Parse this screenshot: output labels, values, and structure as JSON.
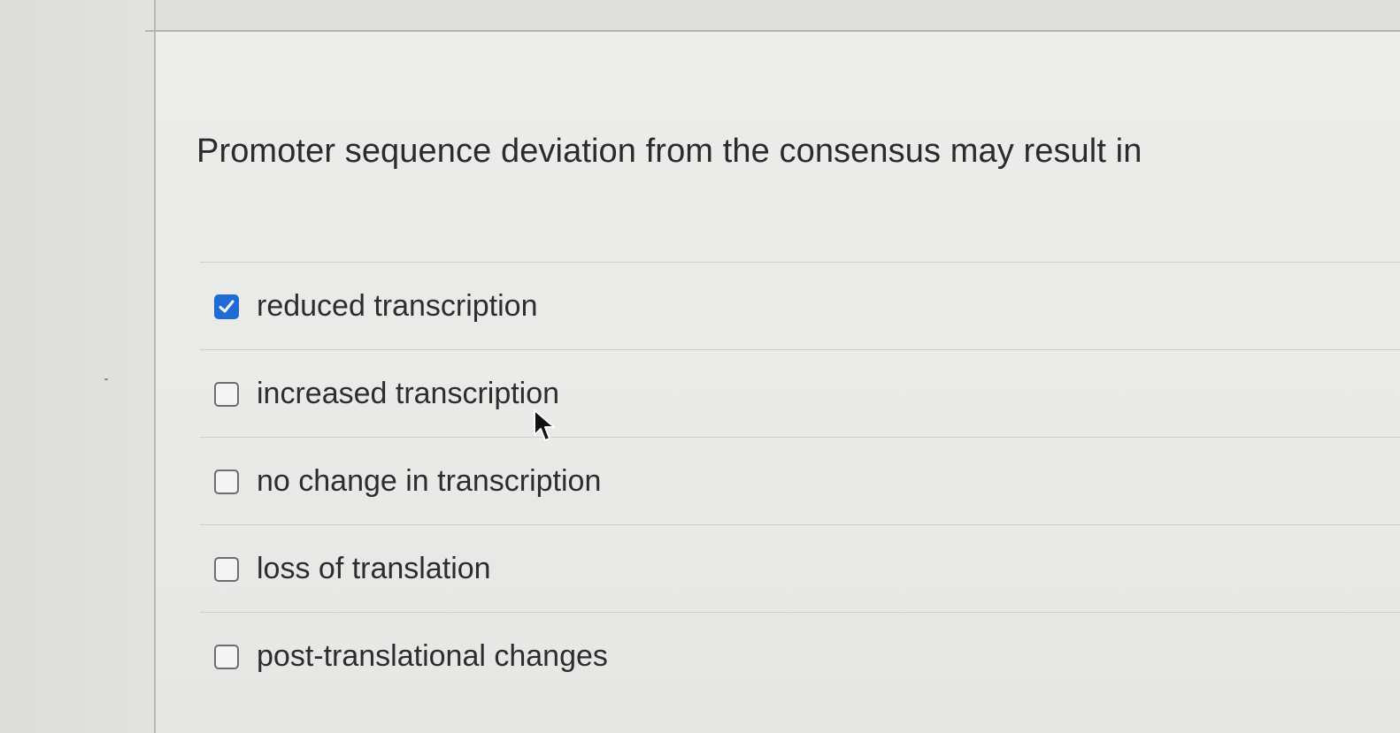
{
  "question": {
    "text": "Promoter sequence deviation from the consensus may result in"
  },
  "answers": [
    {
      "label": "reduced transcription",
      "checked": true
    },
    {
      "label": "increased transcription",
      "checked": false
    },
    {
      "label": "no change in transcription",
      "checked": false
    },
    {
      "label": "loss of translation",
      "checked": false
    },
    {
      "label": "post-translational changes",
      "checked": false
    }
  ],
  "colors": {
    "checkbox_checked": "#1f6bd6",
    "checkbox_border": "#6d6d6d",
    "text": "#2b2b2b"
  },
  "icons": {
    "checked": "checkmark-icon",
    "cursor": "mouse-pointer-icon"
  }
}
